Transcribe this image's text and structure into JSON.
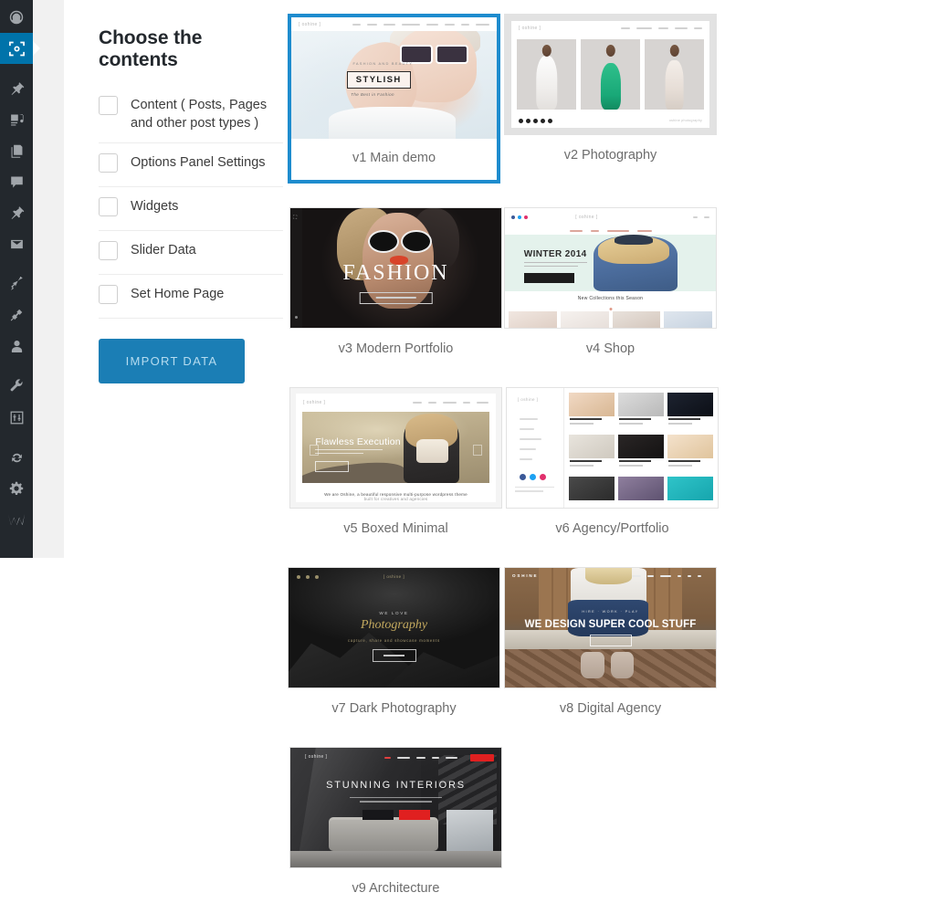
{
  "sidebar": {
    "items": [
      {
        "name": "dashboard",
        "icon": "dashboard-icon",
        "active": false
      },
      {
        "name": "oshine-options",
        "icon": "fullscreen-brackets-icon",
        "active": true
      },
      {
        "name": "posts",
        "icon": "pin-icon",
        "active": false
      },
      {
        "name": "media",
        "icon": "media-icon",
        "active": false
      },
      {
        "name": "pages",
        "icon": "pages-icon",
        "active": false
      },
      {
        "name": "comments",
        "icon": "comment-icon",
        "active": false
      },
      {
        "name": "portfolio",
        "icon": "pin-icon",
        "active": false
      },
      {
        "name": "contact",
        "icon": "envelope-icon",
        "active": false
      },
      {
        "name": "appearance",
        "icon": "brush-icon",
        "active": false
      },
      {
        "name": "plugins",
        "icon": "plug-icon",
        "active": false
      },
      {
        "name": "users",
        "icon": "user-icon",
        "active": false
      },
      {
        "name": "tools",
        "icon": "wrench-icon",
        "active": false
      },
      {
        "name": "settings-sliders",
        "icon": "sliders-icon",
        "active": false
      },
      {
        "name": "updates",
        "icon": "sync-icon",
        "active": false
      },
      {
        "name": "options-gear",
        "icon": "gear-icon",
        "active": false
      },
      {
        "name": "brand-logo",
        "icon": "m-logo-icon",
        "active": false
      }
    ]
  },
  "panel": {
    "title": "Choose the contents",
    "options": [
      {
        "label": "Content ( Posts, Pages and other post types )",
        "checked": false
      },
      {
        "label": "Options Panel Settings",
        "checked": false
      },
      {
        "label": "Widgets",
        "checked": false
      },
      {
        "label": "Slider Data",
        "checked": false
      },
      {
        "label": "Set Home Page",
        "checked": false
      }
    ],
    "import_button": "IMPORT DATA",
    "accent_color": "#1b7eb5",
    "selected_border_color": "#1e8cce"
  },
  "demos": [
    {
      "label": "v1 Main demo",
      "selected": true,
      "headline": "STYLISH",
      "tagline": "The Best in Fashion",
      "eyebrow": "FASHION AND BEAUTY"
    },
    {
      "label": "v2 Photography",
      "selected": false
    },
    {
      "label": "v3 Modern Portfolio",
      "selected": false,
      "headline": "FASHION"
    },
    {
      "label": "v4 Shop",
      "selected": false,
      "headline": "WINTER 2014",
      "section": "New Collections this Season"
    },
    {
      "label": "v5 Boxed Minimal",
      "selected": false,
      "headline": "Flawless Execution",
      "caption": "We are Oshine, a beautiful responsive multi-purpose wordpress theme"
    },
    {
      "label": "v6 Agency/Portfolio",
      "selected": false
    },
    {
      "label": "v7 Dark Photography",
      "selected": false,
      "eyebrow": "WE LOVE",
      "headline": "Photography"
    },
    {
      "label": "v8 Digital Agency",
      "selected": false,
      "brand": "OSHINE",
      "headline": "WE DESIGN SUPER COOL STUFF"
    },
    {
      "label": "v9 Architecture",
      "selected": false,
      "headline": "STUNNING INTERIORS"
    }
  ]
}
